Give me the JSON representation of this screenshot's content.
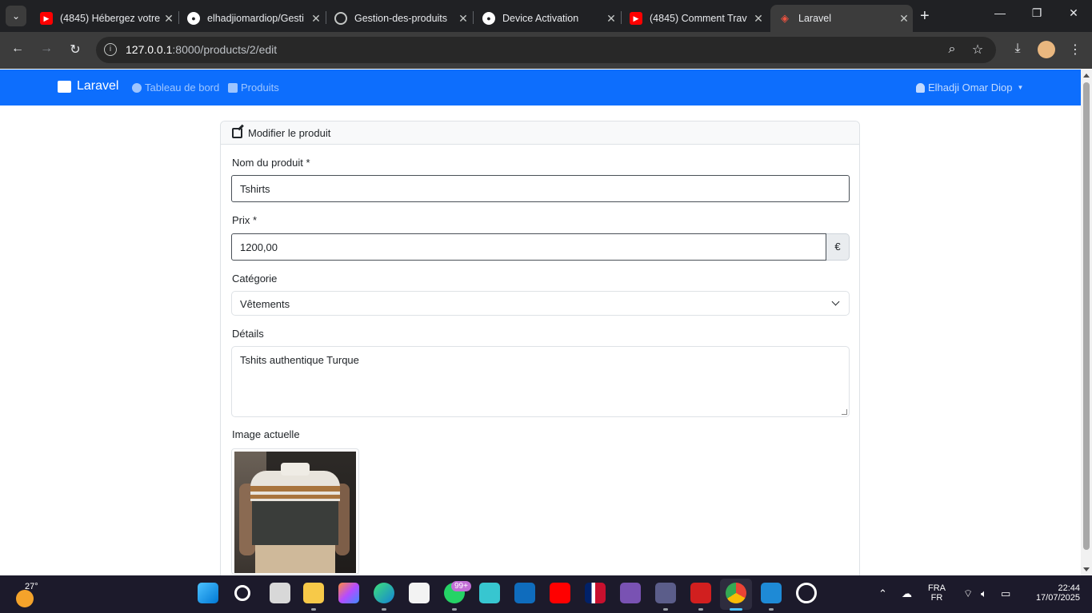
{
  "browser": {
    "tabs": [
      {
        "title": "(4845) Hébergez votre",
        "favicon": "youtube-icon",
        "color": "#ff0000",
        "active": false
      },
      {
        "title": "elhadjiomardiop/Gesti",
        "favicon": "github-icon",
        "color": "#ffffff",
        "active": false
      },
      {
        "title": "Gestion-des-produits",
        "favicon": "globe-icon",
        "color": "#c4c7c5",
        "active": false
      },
      {
        "title": "Device Activation",
        "favicon": "github-icon",
        "color": "#ffffff",
        "active": false
      },
      {
        "title": "(4845) Comment Trav",
        "favicon": "youtube-icon",
        "color": "#ff0000",
        "active": false
      },
      {
        "title": "Laravel",
        "favicon": "laravel-icon",
        "color": "#f05340",
        "active": true
      }
    ],
    "url_host": "127.0.0.1",
    "url_path": ":8000/products/2/edit"
  },
  "navbar": {
    "brand": "Laravel",
    "links": [
      "Tableau de bord",
      "Produits"
    ],
    "user": "Elhadji Omar Diop",
    "color": "#0d6efd"
  },
  "form": {
    "header": "Modifier le produit",
    "name_label": "Nom du produit *",
    "name_value": "Tshirts",
    "price_label": "Prix *",
    "price_value": "1200,00",
    "currency": "€",
    "category_label": "Catégorie",
    "category_value": "Vêtements",
    "details_label": "Détails",
    "details_value": "Tshits authentique Turque",
    "image_label": "Image actuelle"
  },
  "taskbar": {
    "temperature": "27°",
    "badge": "99+",
    "lang1": "FRA",
    "lang2": "FR",
    "time": "22:44",
    "date": "17/07/2025"
  }
}
